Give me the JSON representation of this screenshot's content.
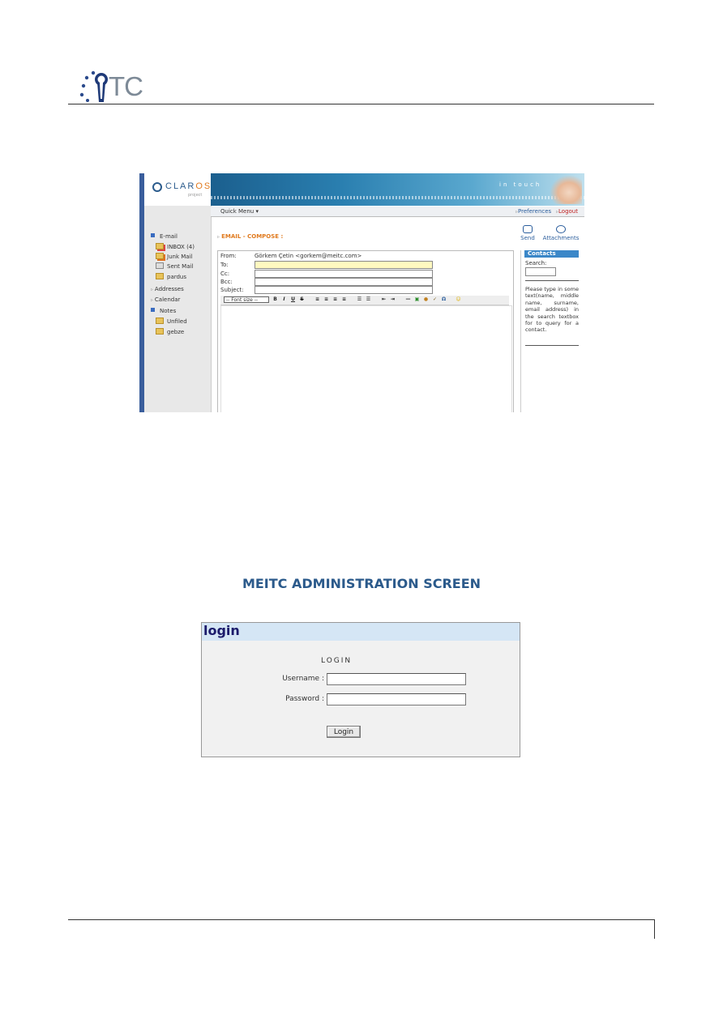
{
  "header": {
    "logo_text": "TC"
  },
  "claros": {
    "brand": "CLAROS",
    "brand_sub": "project",
    "banner_text": "in touch",
    "quick_menu": "Quick Menu",
    "preferences": "Preferences",
    "logout": "Logout",
    "sidebar": {
      "email": "E-mail",
      "inbox": "INBOX (4)",
      "junk": "Junk Mail",
      "sent": "Sent Mail",
      "pardus": "pardus",
      "addresses": "Addresses",
      "calendar": "Calendar",
      "notes": "Notes",
      "unfiled": "Unfiled",
      "gebze": "gebze"
    },
    "compose_title": "EMAIL - COMPOSE :",
    "send": "Send",
    "attachments": "Attachments",
    "form": {
      "from_label": "From:",
      "from_value": "Görkem Çetin <gorkem@meitc.com>",
      "to_label": "To:",
      "cc_label": "Cc:",
      "bcc_label": "Bcc:",
      "subject_label": "Subject:",
      "font_size": "-- Font size --"
    },
    "contacts": {
      "header": "Contacts",
      "search_label": "Search:",
      "help": "Please type in some text(name, middle name, surname, email address) in the search textbox for to query for a contact."
    }
  },
  "admin_title": "MEITC ADMINISTRATION SCREEN",
  "login": {
    "header": "login",
    "caption": "LOGIN",
    "username_label": "Username :",
    "password_label": "Password :",
    "button": "Login"
  }
}
